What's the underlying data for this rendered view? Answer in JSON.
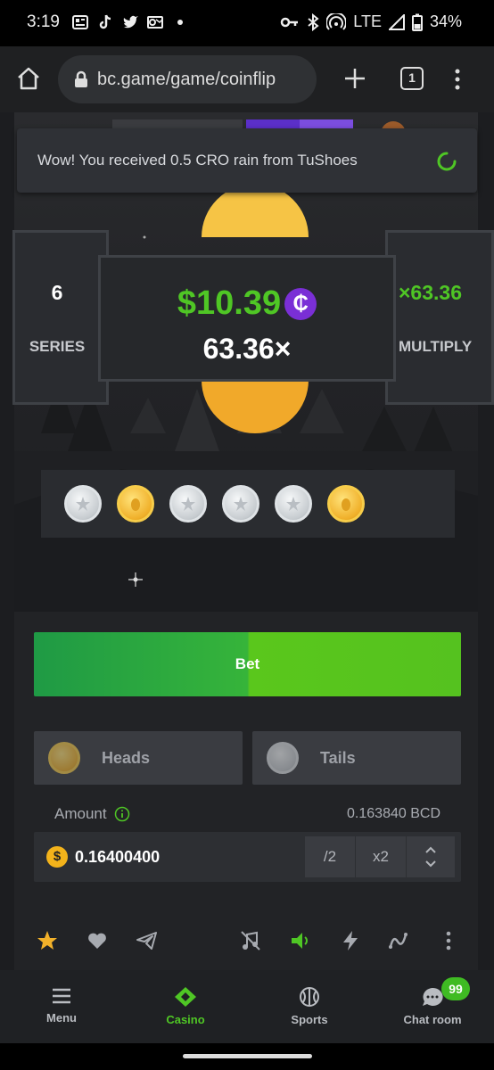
{
  "status_bar": {
    "time": "3:19",
    "network": "LTE",
    "battery": "34%"
  },
  "browser": {
    "url": "bc.game/game/coinflip",
    "tab_count": "1"
  },
  "toast": {
    "message": "Wow! You received 0.5 CRO rain from TuShoes"
  },
  "series_panel": {
    "value": "6",
    "label": "SERIES"
  },
  "multiply_panel": {
    "value": "×63.36",
    "label": "MULTIPLY"
  },
  "win": {
    "amount": "$10.39",
    "currency_symbol": "₵",
    "multiplier": "63.36×"
  },
  "history": {
    "coins": [
      "silver",
      "gold",
      "silver",
      "silver",
      "silver",
      "gold"
    ]
  },
  "bet_button": {
    "label": "Bet"
  },
  "sides": {
    "heads": "Heads",
    "tails": "Tails"
  },
  "amount": {
    "label": "Amount",
    "balance": "0.163840 BCD",
    "value": "0.16400400",
    "half": "/2",
    "double": "x2"
  },
  "bottom_nav": {
    "menu": "Menu",
    "casino": "Casino",
    "sports": "Sports",
    "chat": "Chat room",
    "chat_badge": "99"
  },
  "colors": {
    "accent_green": "#4fc625",
    "cro_purple": "#7a2fd6",
    "bcd_gold": "#f3b31b"
  }
}
